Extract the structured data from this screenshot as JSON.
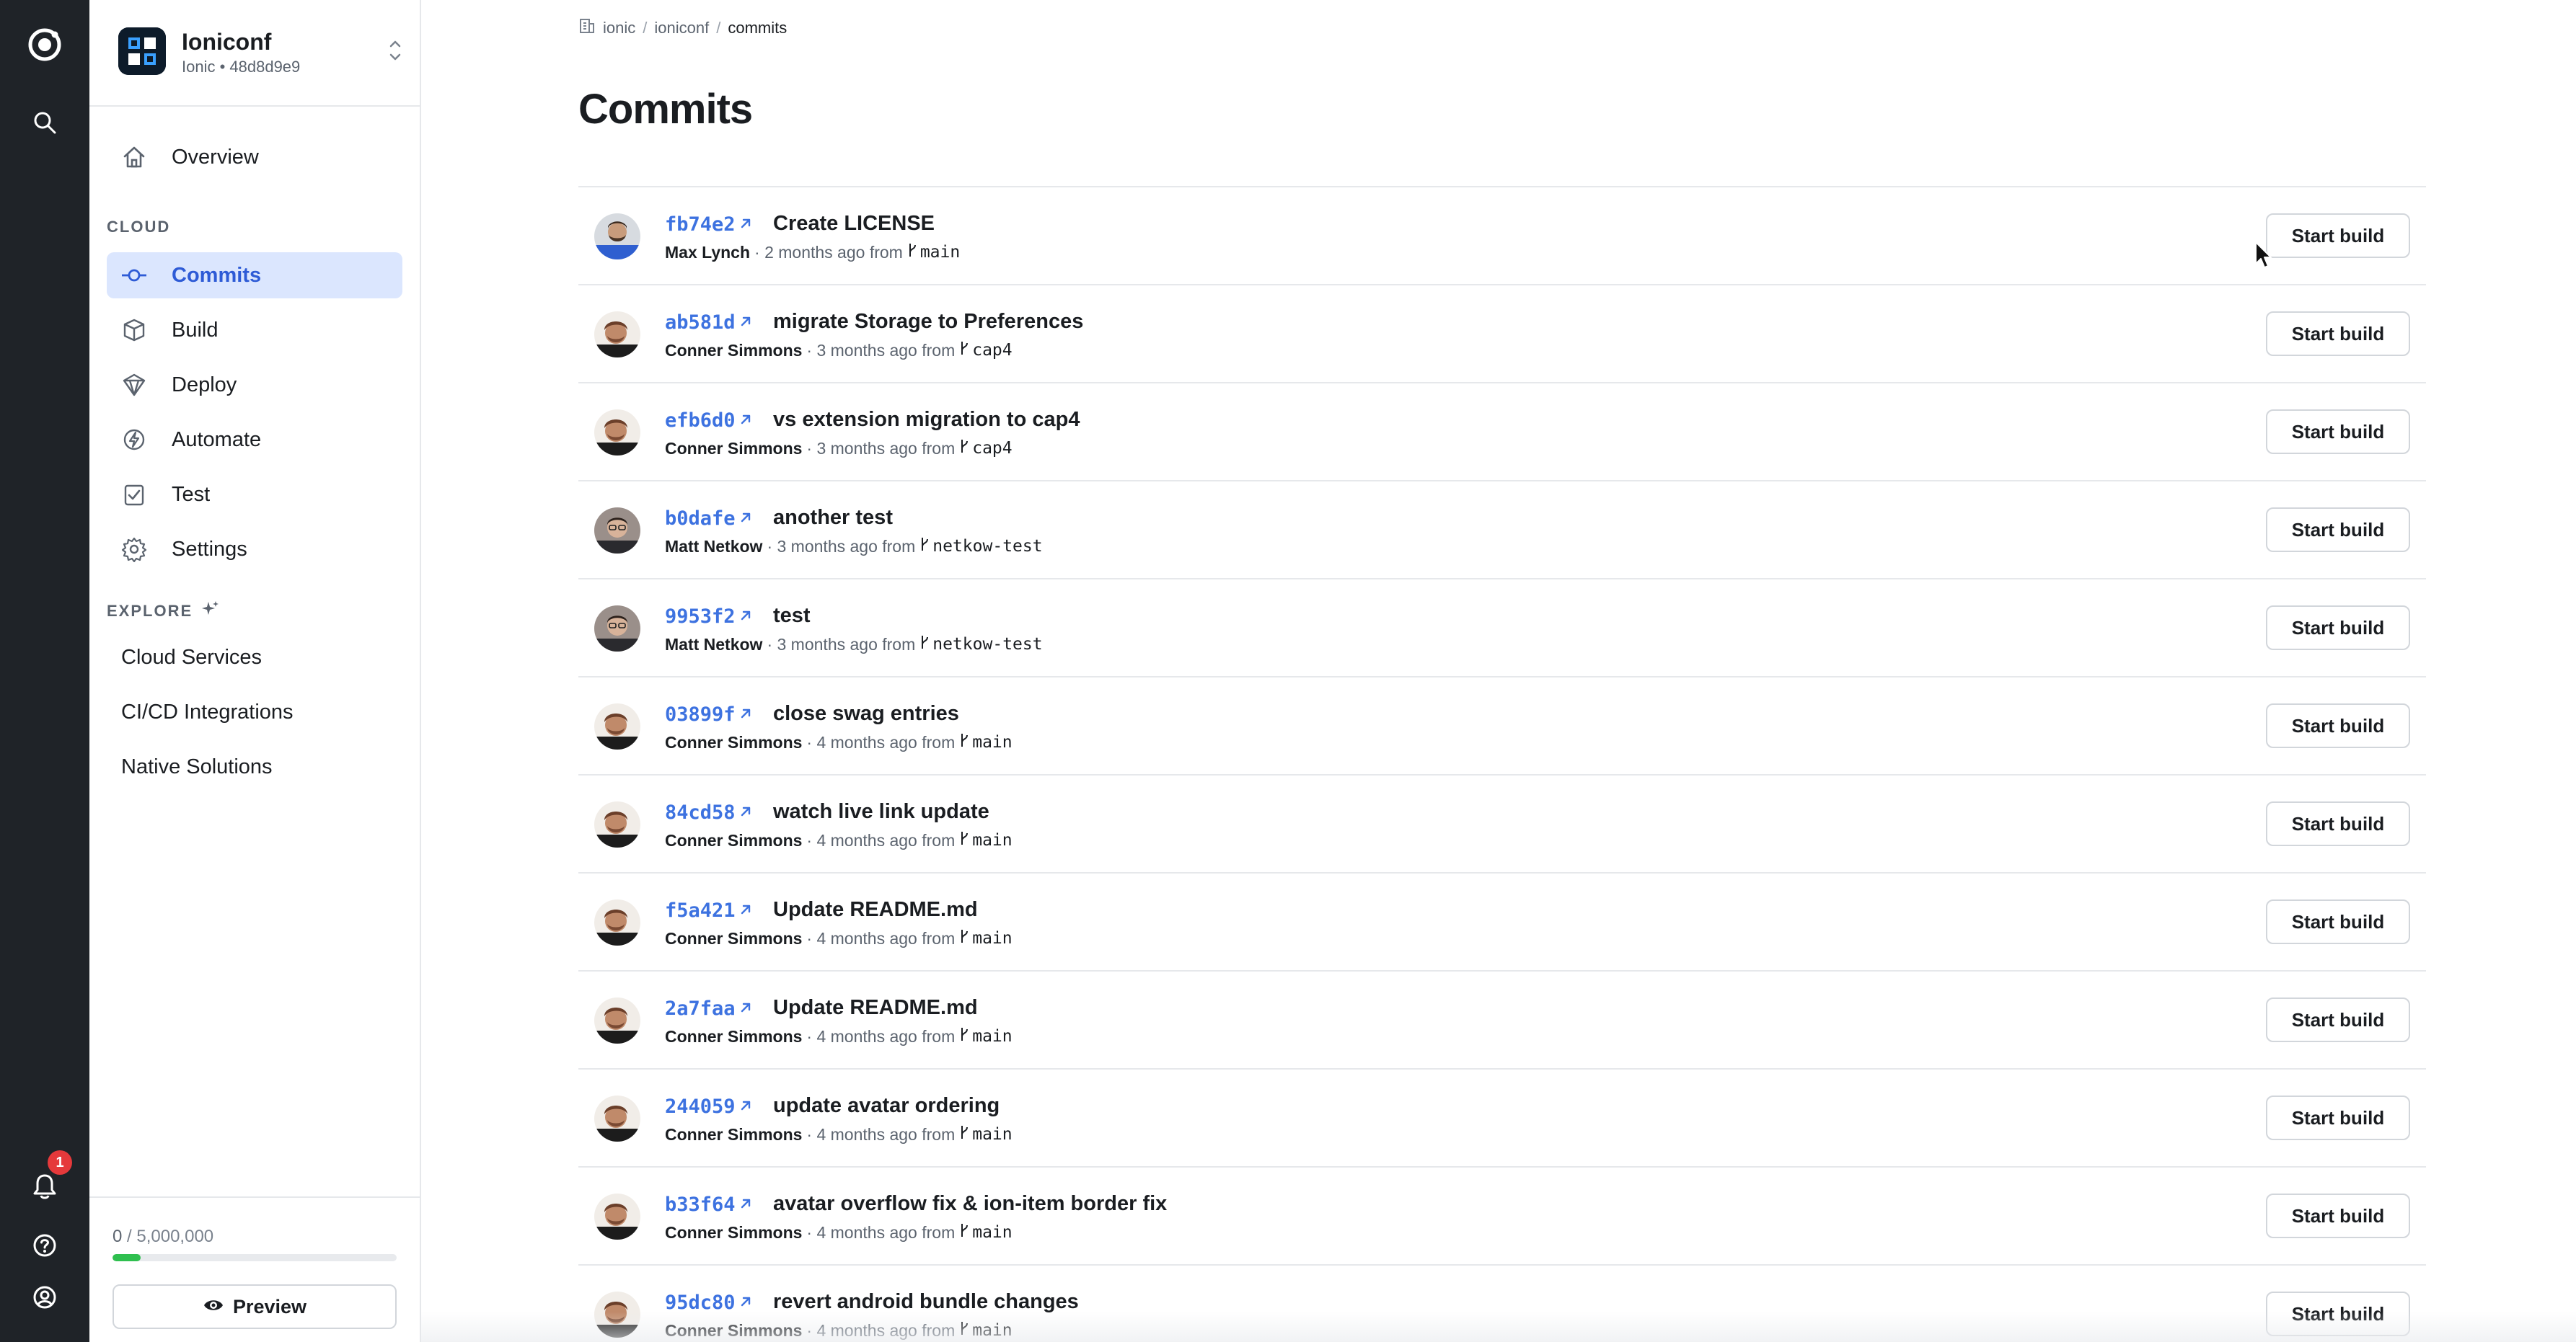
{
  "app": {
    "name": "Ioniconf",
    "subtitle": "Ionic • 48d8d9e9"
  },
  "rail": {
    "logo_icon": "ionic-logo-icon",
    "search_icon": "search-icon",
    "notifications_count": "1",
    "help_icon": "help-icon",
    "account_icon": "account-icon"
  },
  "sidebar": {
    "overview": "Overview",
    "cloud_section": "CLOUD",
    "items": [
      {
        "label": "Commits",
        "icon": "commit-icon",
        "active": true
      },
      {
        "label": "Build",
        "icon": "cube-icon",
        "active": false
      },
      {
        "label": "Deploy",
        "icon": "deploy-icon",
        "active": false
      },
      {
        "label": "Automate",
        "icon": "automate-icon",
        "active": false
      },
      {
        "label": "Test",
        "icon": "test-icon",
        "active": false
      },
      {
        "label": "Settings",
        "icon": "gear-icon",
        "active": false
      }
    ],
    "explore_section": "EXPLORE",
    "explore_items": [
      "Cloud Services",
      "CI/CD Integrations",
      "Native Solutions"
    ],
    "usage_used": "0",
    "usage_total": " / 5,000,000",
    "usage_fraction": 0.1,
    "preview_label": "Preview"
  },
  "breadcrumb": {
    "org": "ionic",
    "app": "ioniconf",
    "current": "commits",
    "sep": "/"
  },
  "page_title": "Commits",
  "commits": [
    {
      "sha": "fb74e2",
      "message": "Create LICENSE",
      "author": "Max Lynch",
      "when": "· 2 months ago from",
      "branch": "main",
      "avatar": "max"
    },
    {
      "sha": "ab581d",
      "message": "migrate Storage to Preferences",
      "author": "Conner Simmons",
      "when": "· 3 months ago from",
      "branch": "cap4",
      "avatar": "conner"
    },
    {
      "sha": "efb6d0",
      "message": "vs extension migration to cap4",
      "author": "Conner Simmons",
      "when": "· 3 months ago from",
      "branch": "cap4",
      "avatar": "conner"
    },
    {
      "sha": "b0dafe",
      "message": "another test",
      "author": "Matt Netkow",
      "when": "· 3 months ago from",
      "branch": "netkow-test",
      "avatar": "matt"
    },
    {
      "sha": "9953f2",
      "message": "test",
      "author": "Matt Netkow",
      "when": "· 3 months ago from",
      "branch": "netkow-test",
      "avatar": "matt"
    },
    {
      "sha": "03899f",
      "message": "close swag entries",
      "author": "Conner Simmons",
      "when": "· 4 months ago from",
      "branch": "main",
      "avatar": "conner"
    },
    {
      "sha": "84cd58",
      "message": "watch live link update",
      "author": "Conner Simmons",
      "when": "· 4 months ago from",
      "branch": "main",
      "avatar": "conner"
    },
    {
      "sha": "f5a421",
      "message": "Update README.md",
      "author": "Conner Simmons",
      "when": "· 4 months ago from",
      "branch": "main",
      "avatar": "conner"
    },
    {
      "sha": "2a7faa",
      "message": "Update README.md",
      "author": "Conner Simmons",
      "when": "· 4 months ago from",
      "branch": "main",
      "avatar": "conner"
    },
    {
      "sha": "244059",
      "message": "update avatar ordering",
      "author": "Conner Simmons",
      "when": "· 4 months ago from",
      "branch": "main",
      "avatar": "conner"
    },
    {
      "sha": "b33f64",
      "message": "avatar overflow fix & ion-item border fix",
      "author": "Conner Simmons",
      "when": "· 4 months ago from",
      "branch": "main",
      "avatar": "conner"
    },
    {
      "sha": "95dc80",
      "message": "revert android bundle changes",
      "author": "Conner Simmons",
      "when": "· 4 months ago from",
      "branch": "main",
      "avatar": "conner"
    }
  ],
  "build_button_label": "Start build",
  "colors": {
    "accent": "#3d72e0",
    "active_bg": "#dbe6fe",
    "rail_bg": "#1f2328",
    "badge": "#e5393b",
    "usage": "#2fbf4f"
  }
}
